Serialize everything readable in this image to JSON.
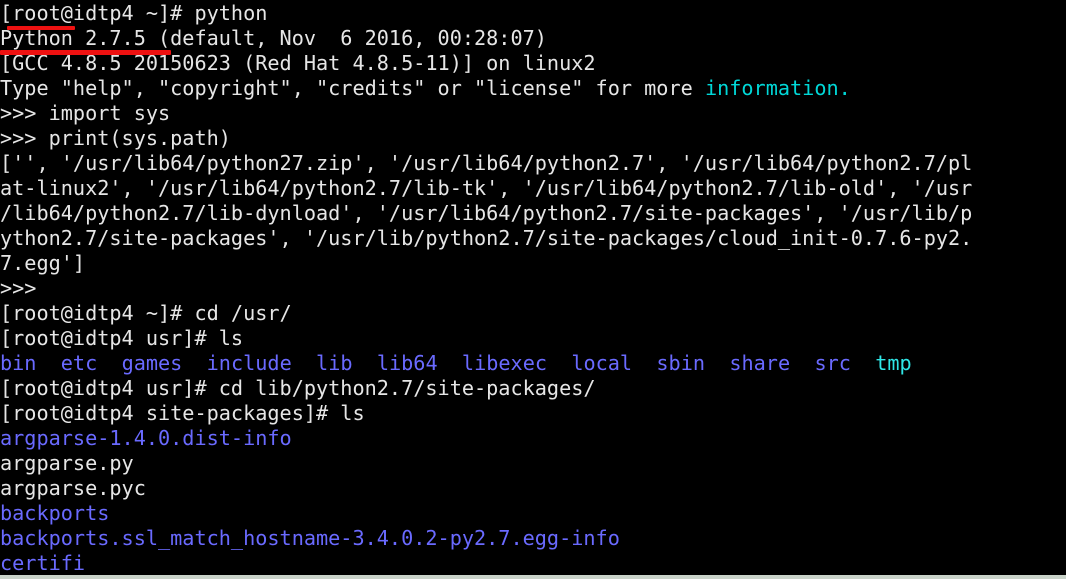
{
  "terminal": {
    "title": "root@idtp4:/usr/lib/python2.7/site-packages",
    "background_color": "#000000",
    "foreground_color": "#e6e6e6",
    "colors": {
      "default": "#e6e6e6",
      "cyan": "#00d7d7",
      "blue_directory": "#6a6aff",
      "cyan_sticky_dir": "#2fe6e6",
      "annotation_red": "#ee1111",
      "bottom_edge": "#c9d3c9"
    },
    "prompt_user": "root",
    "prompt_host": "idtp4",
    "python_prompt": ">>>"
  },
  "annotations": [
    {
      "name": "underline-hostname",
      "target_text": "root@idtp",
      "color": "#ee1111"
    },
    {
      "name": "underline-python-version",
      "target_text": "Python 2.7.5",
      "color": "#ee1111"
    }
  ],
  "lines": [
    {
      "id": 0,
      "segments": [
        {
          "text": "[root@idtp4 ~]# python",
          "color": "default"
        }
      ]
    },
    {
      "id": 1,
      "segments": [
        {
          "text": "Python 2.7.5 (default, Nov  6 2016, 00:28:07)",
          "color": "default"
        }
      ]
    },
    {
      "id": 2,
      "segments": [
        {
          "text": "[GCC 4.8.5 20150623 (Red Hat 4.8.5-11)] on linux2",
          "color": "default"
        }
      ]
    },
    {
      "id": 3,
      "segments": [
        {
          "text": "Type \"help\", \"copyright\", \"credits\" or \"license\" for more ",
          "color": "default"
        },
        {
          "text": "information.",
          "color": "cyan"
        }
      ]
    },
    {
      "id": 4,
      "segments": [
        {
          "text": ">>> import sys",
          "color": "default"
        }
      ]
    },
    {
      "id": 5,
      "segments": [
        {
          "text": ">>> print(sys.path)",
          "color": "default"
        }
      ]
    },
    {
      "id": 6,
      "segments": [
        {
          "text": "['', '/usr/lib64/python27.zip', '/usr/lib64/python2.7', '/usr/lib64/python2.7/pl",
          "color": "default"
        }
      ]
    },
    {
      "id": 7,
      "segments": [
        {
          "text": "at-linux2', '/usr/lib64/python2.7/lib-tk', '/usr/lib64/python2.7/lib-old', '/usr",
          "color": "default"
        }
      ]
    },
    {
      "id": 8,
      "segments": [
        {
          "text": "/lib64/python2.7/lib-dynload', '/usr/lib64/python2.7/site-packages', '/usr/lib/p",
          "color": "default"
        }
      ]
    },
    {
      "id": 9,
      "segments": [
        {
          "text": "ython2.7/site-packages', '/usr/lib/python2.7/site-packages/cloud_init-0.7.6-py2.",
          "color": "default"
        }
      ]
    },
    {
      "id": 10,
      "segments": [
        {
          "text": "7.egg']",
          "color": "default"
        }
      ]
    },
    {
      "id": 11,
      "segments": [
        {
          "text": ">>>",
          "color": "default"
        }
      ]
    },
    {
      "id": 12,
      "segments": [
        {
          "text": "[root@idtp4 ~]# cd /usr/",
          "color": "default"
        }
      ]
    },
    {
      "id": 13,
      "segments": [
        {
          "text": "[root@idtp4 usr]# ls",
          "color": "default"
        }
      ]
    },
    {
      "id": 14,
      "segments": [
        {
          "text": "bin",
          "color": "blue"
        },
        {
          "text": "  ",
          "color": "default"
        },
        {
          "text": "etc",
          "color": "blue"
        },
        {
          "text": "  ",
          "color": "default"
        },
        {
          "text": "games",
          "color": "blue"
        },
        {
          "text": "  ",
          "color": "default"
        },
        {
          "text": "include",
          "color": "blue"
        },
        {
          "text": "  ",
          "color": "default"
        },
        {
          "text": "lib",
          "color": "blue"
        },
        {
          "text": "  ",
          "color": "default"
        },
        {
          "text": "lib64",
          "color": "blue"
        },
        {
          "text": "  ",
          "color": "default"
        },
        {
          "text": "libexec",
          "color": "blue"
        },
        {
          "text": "  ",
          "color": "default"
        },
        {
          "text": "local",
          "color": "blue"
        },
        {
          "text": "  ",
          "color": "default"
        },
        {
          "text": "sbin",
          "color": "blue"
        },
        {
          "text": "  ",
          "color": "default"
        },
        {
          "text": "share",
          "color": "blue"
        },
        {
          "text": "  ",
          "color": "default"
        },
        {
          "text": "src",
          "color": "blue"
        },
        {
          "text": "  ",
          "color": "default"
        },
        {
          "text": "tmp",
          "color": "tmpcyan"
        }
      ]
    },
    {
      "id": 15,
      "segments": [
        {
          "text": "[root@idtp4 usr]# cd lib/python2.7/site-packages/",
          "color": "default"
        }
      ]
    },
    {
      "id": 16,
      "segments": [
        {
          "text": "[root@idtp4 site-packages]# ls",
          "color": "default"
        }
      ]
    },
    {
      "id": 17,
      "segments": [
        {
          "text": "argparse-1.4.0.dist-info",
          "color": "blue"
        }
      ]
    },
    {
      "id": 18,
      "segments": [
        {
          "text": "argparse.py",
          "color": "default"
        }
      ]
    },
    {
      "id": 19,
      "segments": [
        {
          "text": "argparse.pyc",
          "color": "default"
        }
      ]
    },
    {
      "id": 20,
      "segments": [
        {
          "text": "backports",
          "color": "blue"
        }
      ]
    },
    {
      "id": 21,
      "segments": [
        {
          "text": "backports.ssl_match_hostname-3.4.0.2-py2.7.egg-info",
          "color": "blue"
        }
      ]
    },
    {
      "id": 22,
      "segments": [
        {
          "text": "certifi",
          "color": "blue"
        }
      ]
    }
  ]
}
